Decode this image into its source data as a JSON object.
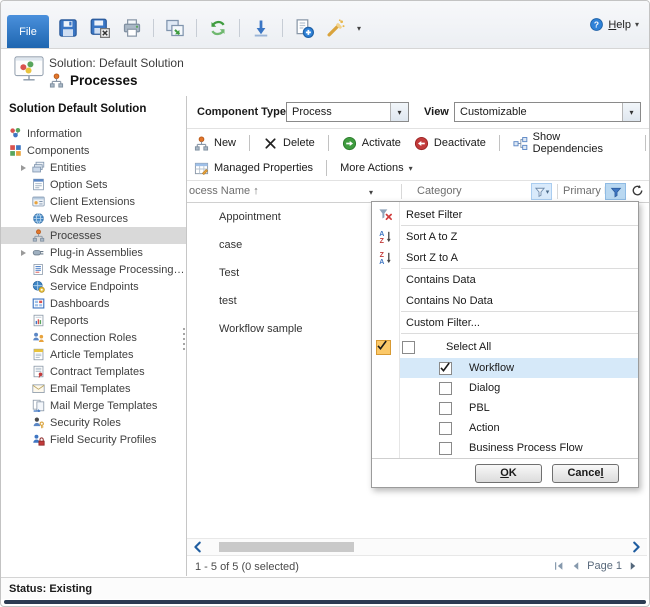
{
  "topbar": {
    "file_tab": "File",
    "icons": [
      "save-icon",
      "save-as-icon",
      "print-icon",
      "sep",
      "copy-window-icon",
      "sep",
      "publish-icon",
      "sep",
      "import-icon",
      "sep",
      "new-record-icon",
      "customize-icon"
    ],
    "help_label": "Help"
  },
  "header": {
    "solution_label": "Solution: Default Solution",
    "page_title": "Processes"
  },
  "sidebar": {
    "title": "Solution Default Solution",
    "items": [
      {
        "label": "Information",
        "icon": "information-icon",
        "indent": 1
      },
      {
        "label": "Components",
        "icon": "components-icon",
        "indent": 1
      },
      {
        "label": "Entities",
        "icon": "entities-icon",
        "indent": 2,
        "expander": true
      },
      {
        "label": "Option Sets",
        "icon": "option-sets-icon",
        "indent": 2
      },
      {
        "label": "Client Extensions",
        "icon": "client-extensions-icon",
        "indent": 2
      },
      {
        "label": "Web Resources",
        "icon": "web-resources-icon",
        "indent": 2
      },
      {
        "label": "Processes",
        "icon": "processes-icon",
        "indent": 2,
        "selected": true
      },
      {
        "label": "Plug-in Assemblies",
        "icon": "plug-in-icon",
        "indent": 2,
        "expander": true
      },
      {
        "label": "Sdk Message Processing S...",
        "icon": "sdk-message-icon",
        "indent": 2
      },
      {
        "label": "Service Endpoints",
        "icon": "service-endpoints-icon",
        "indent": 2
      },
      {
        "label": "Dashboards",
        "icon": "dashboards-icon",
        "indent": 2
      },
      {
        "label": "Reports",
        "icon": "reports-icon",
        "indent": 2
      },
      {
        "label": "Connection Roles",
        "icon": "connection-roles-icon",
        "indent": 2
      },
      {
        "label": "Article Templates",
        "icon": "article-templates-icon",
        "indent": 2
      },
      {
        "label": "Contract Templates",
        "icon": "contract-templates-icon",
        "indent": 2
      },
      {
        "label": "Email Templates",
        "icon": "email-templates-icon",
        "indent": 2
      },
      {
        "label": "Mail Merge Templates",
        "icon": "mail-merge-icon",
        "indent": 2
      },
      {
        "label": "Security Roles",
        "icon": "security-roles-icon",
        "indent": 2
      },
      {
        "label": "Field Security Profiles",
        "icon": "field-security-icon",
        "indent": 2
      }
    ]
  },
  "main": {
    "component_type_label": "Component Type",
    "component_type_value": "Process",
    "view_label": "View",
    "view_value": "Customizable",
    "toolbar_row1": [
      {
        "label": "New",
        "icon": "processes-icon"
      },
      {
        "sep": true
      },
      {
        "label": "Delete",
        "icon": "delete-x-icon"
      },
      {
        "sep": true
      },
      {
        "label": "Activate",
        "icon": "activate-icon"
      },
      {
        "label": "Deactivate",
        "icon": "deactivate-icon"
      },
      {
        "sep": true
      },
      {
        "label": "Show Dependencies",
        "icon": "show-dependencies-icon"
      },
      {
        "sep": true
      }
    ],
    "toolbar_row2": [
      {
        "label": "Managed Properties",
        "icon": "managed-properties-icon"
      },
      {
        "sep": true
      },
      {
        "label": "More Actions",
        "caret": true
      }
    ]
  },
  "grid": {
    "name_header": "ocess Name",
    "sort_indicator": "↑",
    "category_header": "Category",
    "primary_entity_header": "Primary Entity",
    "rows": [
      "Appointment",
      "case",
      "Test",
      "test",
      "Workflow sample"
    ],
    "record_count": "1 - 5 of 5 (0 selected)",
    "page_label": "Page 1"
  },
  "filter_menu": {
    "commands": [
      {
        "label": "Reset Filter",
        "icon": "reset-filter-icon",
        "separator_after": true
      },
      {
        "label": "Sort A to Z",
        "icon": "sort-az-icon"
      },
      {
        "label": "Sort Z to A",
        "icon": "sort-za-icon",
        "separator_after": true
      },
      {
        "label": "Contains Data"
      },
      {
        "label": "Contains No Data",
        "separator_after": true
      },
      {
        "label": "Custom Filter...",
        "separator_after": true
      }
    ],
    "select_all_label": "Select All",
    "filter_active_checked": true,
    "options": [
      {
        "label": "Workflow",
        "checked": true,
        "highlighted": true
      },
      {
        "label": "Dialog",
        "checked": false
      },
      {
        "label": "PBL",
        "checked": false
      },
      {
        "label": "Action",
        "checked": false
      },
      {
        "label": "Business Process Flow",
        "checked": false
      }
    ],
    "ok_label": "OK",
    "cancel_label": "Cancel"
  },
  "status_bar": {
    "text": "Status: Existing"
  },
  "colors": {
    "file_tab_blue": "#2273c3",
    "active_filter_blue": "#b9d8f1",
    "highlight_row_blue": "#d6e9f9",
    "amber_checkbox": "#fbc868",
    "navy_strip": "#2b3b52"
  }
}
